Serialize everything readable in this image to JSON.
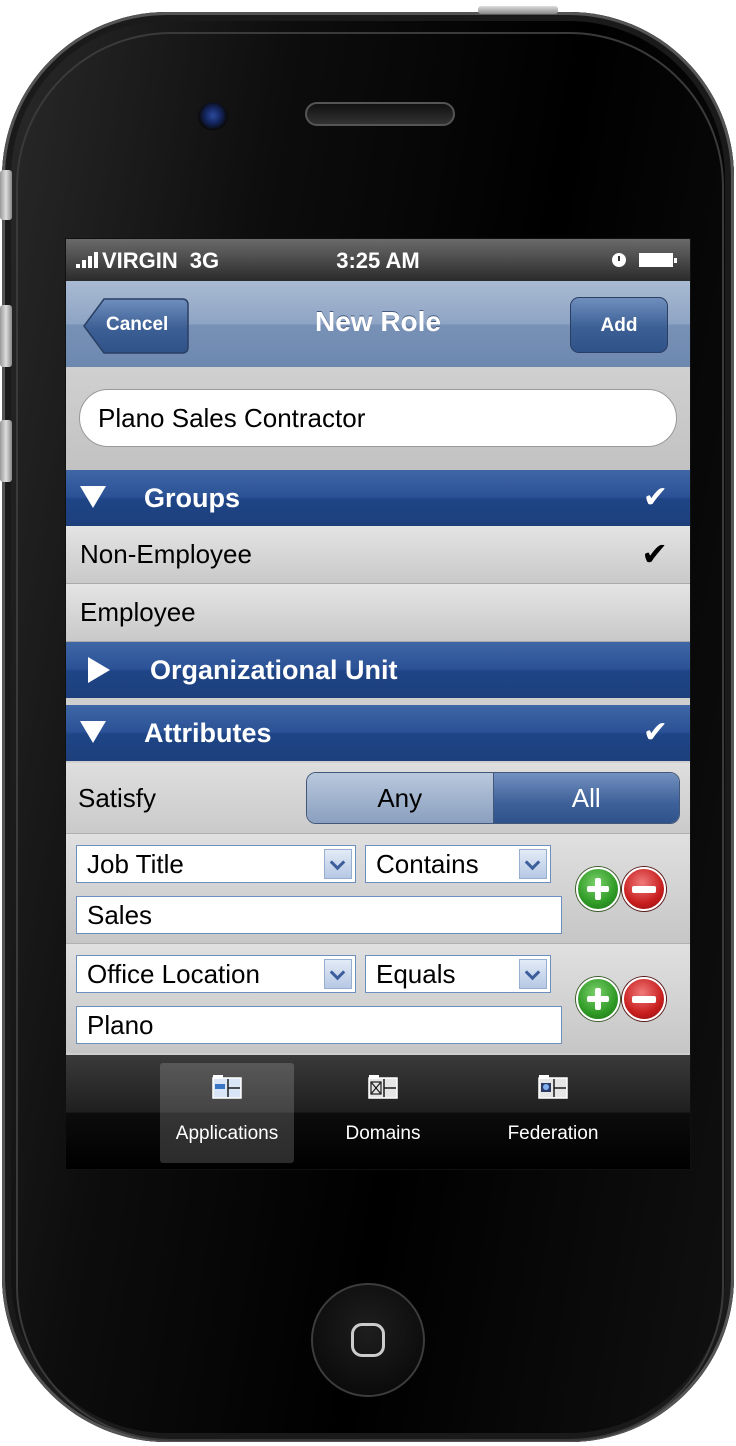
{
  "status_bar": {
    "carrier": "VIRGIN",
    "network": "3G",
    "time": "3:25 AM"
  },
  "nav": {
    "title": "New Role",
    "cancel_label": "Cancel",
    "add_label": "Add"
  },
  "role_name": {
    "value": "Plano Sales Contractor"
  },
  "groups": {
    "label": "Groups",
    "expanded": true,
    "checked": true,
    "check_glyph": "✔",
    "items": [
      {
        "label": "Non-Employee",
        "selected": true
      },
      {
        "label": "Employee",
        "selected": false
      }
    ]
  },
  "org_unit": {
    "label": "Organizational Unit",
    "expanded": false
  },
  "attributes": {
    "label": "Attributes",
    "expanded": true,
    "checked": true,
    "check_glyph": "✔",
    "satisfy_label": "Satisfy",
    "satisfy_options": [
      "Any",
      "All"
    ],
    "satisfy_selected": "All",
    "criteria": [
      {
        "attribute": "Job Title",
        "operator": "Contains",
        "value": "Sales"
      },
      {
        "attribute": "Office Location",
        "operator": "Equals",
        "value": "Plano"
      }
    ]
  },
  "tabs": [
    {
      "label": "Applications",
      "active": true,
      "icon": "applications-icon"
    },
    {
      "label": "Domains",
      "active": false,
      "icon": "domains-icon"
    },
    {
      "label": "Federation",
      "active": false,
      "icon": "federation-icon"
    }
  ],
  "colors": {
    "section_blue": "#2b5296",
    "nav_blue": "#7891b6",
    "add_green": "#2f9a26",
    "remove_red": "#c81e1e"
  }
}
